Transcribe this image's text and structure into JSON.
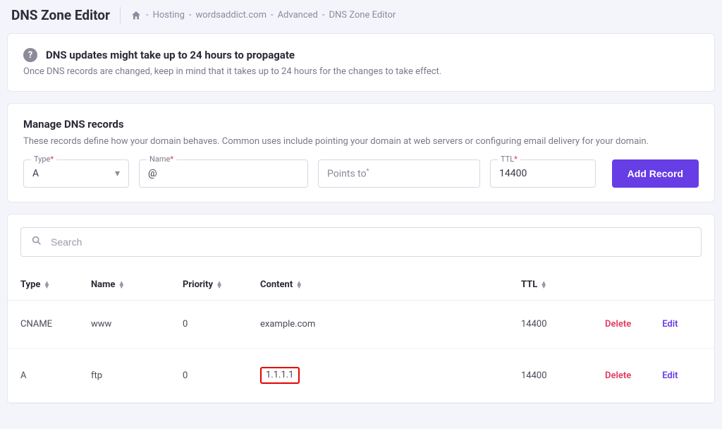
{
  "page_title": "DNS Zone Editor",
  "breadcrumb": {
    "items": [
      "Hosting",
      "wordsaddict.com",
      "Advanced",
      "DNS Zone Editor"
    ],
    "sep": " - "
  },
  "notice": {
    "icon_glyph": "?",
    "title": "DNS updates might take up to 24 hours to propagate",
    "body": "Once DNS records are changed, keep in mind that it takes up to 24 hours for the changes to take effect."
  },
  "manage": {
    "title": "Manage DNS records",
    "desc": "These records define how your domain behaves. Common uses include pointing your domain at web servers or configuring email delivery for your domain.",
    "fields": {
      "type": {
        "label": "Type",
        "required": true,
        "value": "A"
      },
      "name": {
        "label": "Name",
        "required": true,
        "value": "@"
      },
      "points": {
        "label": "Points to",
        "required": true,
        "placeholder": "Points to"
      },
      "ttl": {
        "label": "TTL",
        "required": true,
        "value": "14400"
      }
    },
    "button": "Add Record"
  },
  "search": {
    "placeholder": "Search"
  },
  "table": {
    "headers": {
      "type": "Type",
      "name": "Name",
      "priority": "Priority",
      "content": "Content",
      "ttl": "TTL"
    },
    "actions": {
      "delete": "Delete",
      "edit": "Edit"
    },
    "rows": [
      {
        "type": "CNAME",
        "name": "www",
        "priority": "0",
        "content": "example.com",
        "ttl": "14400",
        "highlight": false
      },
      {
        "type": "A",
        "name": "ftp",
        "priority": "0",
        "content": "1.1.1.1",
        "ttl": "14400",
        "highlight": true
      }
    ]
  }
}
